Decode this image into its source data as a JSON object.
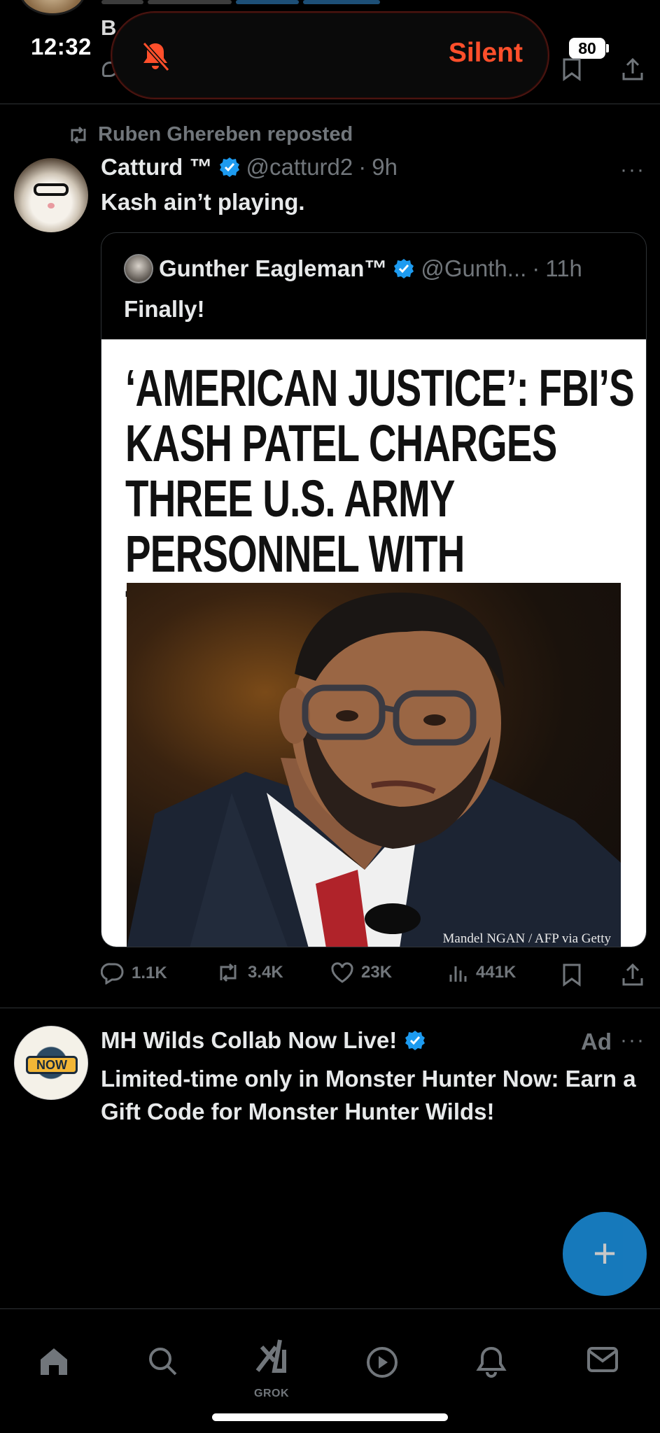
{
  "status_bar": {
    "time": "12:32",
    "silent_label": "Silent",
    "battery": "80"
  },
  "previous_tweet": {
    "partial_text": "B"
  },
  "tweet": {
    "reposted_by": "Ruben Ghereben reposted",
    "author_name": "Catturd ™",
    "handle": "@catturd2",
    "dot": "·",
    "time": "9h",
    "text": "Kash ain’t playing.",
    "more": "···"
  },
  "quote": {
    "author_name": "Gunther Eagleman™",
    "handle": "@Gunth...",
    "dot": "·",
    "time": "11h",
    "text": "Finally!",
    "headline_lines": [
      "‘AMERICAN JUSTICE’: FBI’S",
      "KASH PATEL CHARGES",
      "THREE U.S. ARMY",
      "PERSONNEL WITH TREASON"
    ],
    "photo_credit": "Mandel NGAN / AFP via Getty"
  },
  "actions": {
    "replies": "1.1K",
    "reposts": "3.4K",
    "likes": "23K",
    "views": "441K"
  },
  "ad": {
    "title": "MH Wilds Collab Now Live!",
    "label": "Ad",
    "more": "···",
    "body": "Limited-time only in Monster Hunter Now: Earn a Gift Code for Monster Hunter Wilds!",
    "avatar_text": "NOW"
  },
  "nav": {
    "grok_label": "GROK"
  },
  "fab": {
    "label": "+"
  },
  "colors": {
    "accent": "#1d9bf0",
    "silent": "#ff4f2b",
    "muted": "#71767b",
    "text": "#e7e9ea"
  }
}
